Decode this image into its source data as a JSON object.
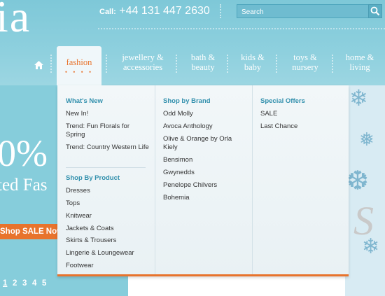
{
  "header": {
    "logo_text": "ia",
    "phone_label": "Call:",
    "phone_number": "+44 131 447 2630",
    "search_placeholder": "Search"
  },
  "nav": {
    "items": [
      {
        "label": "fashion",
        "active": true
      },
      {
        "label": "jewellery &\naccessories"
      },
      {
        "label": "bath &\nbeauty"
      },
      {
        "label": "kids &\nbaby"
      },
      {
        "label": "toys &\nnursery"
      },
      {
        "label": "home &\nliving"
      }
    ],
    "active_dots": "• • • •"
  },
  "menu": {
    "whats_new": {
      "heading": "What's New",
      "links": [
        "New In!",
        "Trend: Fun Florals for Spring",
        "Trend: Country Western Life"
      ]
    },
    "shop_by_product": {
      "heading": "Shop By Product",
      "links": [
        "Dresses",
        "Tops",
        "Knitwear",
        "Jackets & Coats",
        "Skirts & Trousers",
        "Lingerie & Loungewear",
        "Footwear"
      ]
    },
    "shop_by_brand": {
      "heading": "Shop by Brand",
      "links": [
        "Odd Molly",
        "Avoca Anthology",
        "Olive & Orange by Orla Kiely",
        "Bensimon",
        "Gwynedds",
        "Penelope Chilvers",
        "Bohemia"
      ]
    },
    "special_offers": {
      "heading": "Special Offers",
      "links": [
        "SALE",
        "Last Chance"
      ]
    }
  },
  "banner": {
    "big_text": "0%",
    "sub_text": "ted Fas",
    "cta": "Shop SALE Now",
    "pages": [
      "1",
      "2",
      "3",
      "4",
      "5"
    ],
    "current_page": "1"
  },
  "colors": {
    "accent": "#e8732c",
    "header_bg": "#8ed0de",
    "link_heading": "#3390ad"
  }
}
